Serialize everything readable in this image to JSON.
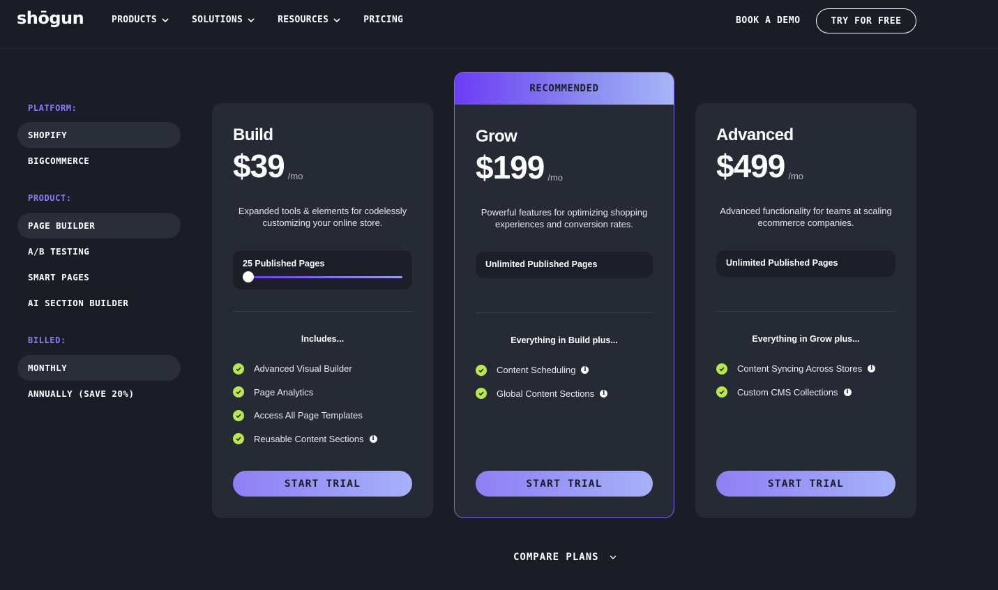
{
  "header": {
    "logo": "shōgun",
    "nav": [
      {
        "label": "PRODUCTS",
        "has_dropdown": true
      },
      {
        "label": "SOLUTIONS",
        "has_dropdown": true
      },
      {
        "label": "RESOURCES",
        "has_dropdown": true
      },
      {
        "label": "PRICING",
        "has_dropdown": false
      }
    ],
    "book_demo": "BOOK A DEMO",
    "try_free": "TRY FOR FREE"
  },
  "sidebar": {
    "platform": {
      "title": "PLATFORM:",
      "items": [
        {
          "label": "SHOPIFY",
          "selected": true
        },
        {
          "label": "BIGCOMMERCE",
          "selected": false
        }
      ]
    },
    "product": {
      "title": "PRODUCT:",
      "items": [
        {
          "label": "PAGE BUILDER",
          "selected": true
        },
        {
          "label": "A/B TESTING",
          "selected": false
        },
        {
          "label": "SMART PAGES",
          "selected": false
        },
        {
          "label": "AI SECTION BUILDER",
          "selected": false
        }
      ]
    },
    "billed": {
      "title": "BILLED:",
      "items": [
        {
          "label": "MONTHLY",
          "selected": true
        },
        {
          "label": "ANNUALLY (SAVE 20%)",
          "selected": false
        }
      ]
    }
  },
  "plans": {
    "build": {
      "name": "Build",
      "price": "$39",
      "per": "/mo",
      "description": "Expanded tools & elements for codelessly customizing your online store.",
      "pages": "25 Published Pages",
      "includes_title": "Includes...",
      "features": [
        {
          "label": "Advanced Visual Builder",
          "info": false
        },
        {
          "label": "Page Analytics",
          "info": false
        },
        {
          "label": "Access All Page Templates",
          "info": false
        },
        {
          "label": "Reusable Content Sections",
          "info": true
        }
      ],
      "cta": "START TRIAL"
    },
    "grow": {
      "badge": "RECOMMENDED",
      "name": "Grow",
      "price": "$199",
      "per": "/mo",
      "description": "Powerful features for optimizing shopping experiences and conversion rates.",
      "pages": "Unlimited Published Pages",
      "includes_title": "Everything in Build plus...",
      "features": [
        {
          "label": "Content Scheduling",
          "info": true
        },
        {
          "label": "Global Content Sections",
          "info": true
        }
      ],
      "cta": "START TRIAL"
    },
    "advanced": {
      "name": "Advanced",
      "price": "$499",
      "per": "/mo",
      "description": "Advanced functionality for teams at scaling ecommerce companies.",
      "pages": "Unlimited Published Pages",
      "includes_title": "Everything in Grow plus...",
      "features": [
        {
          "label": "Content Syncing Across Stores",
          "info": true
        },
        {
          "label": "Custom CMS Collections",
          "info": true
        }
      ],
      "cta": "START TRIAL"
    }
  },
  "compare_plans": "COMPARE PLANS",
  "colors": {
    "background": "#1a1d26",
    "card": "#262a35",
    "accent_purple": "#8b7cff",
    "check_green": "#b8e84a"
  }
}
